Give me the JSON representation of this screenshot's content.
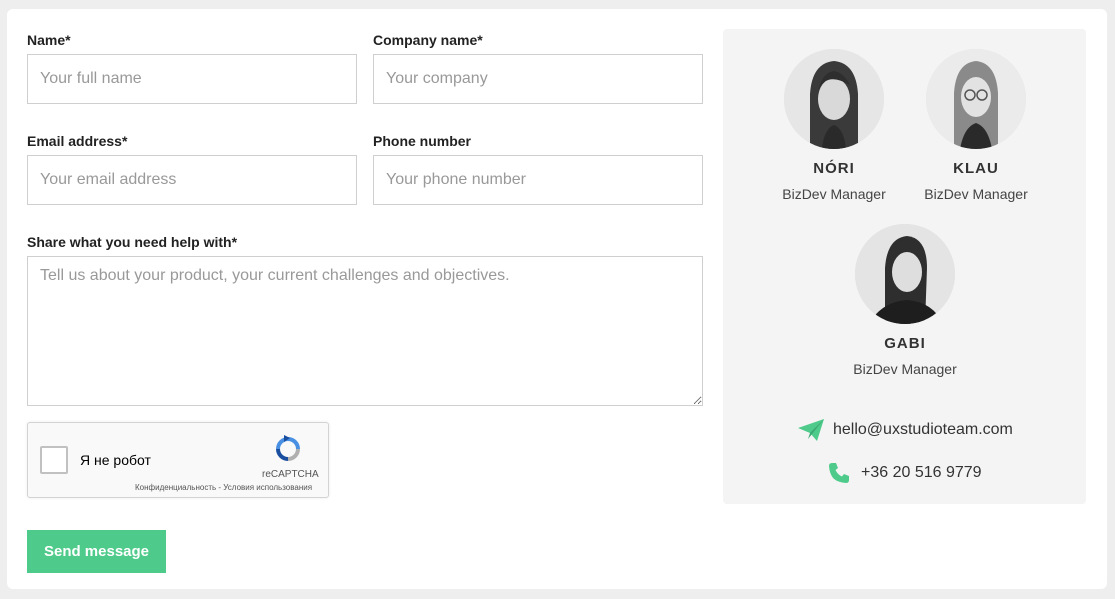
{
  "form": {
    "name_label": "Name*",
    "name_placeholder": "Your full name",
    "company_label": "Company name*",
    "company_placeholder": "Your company",
    "email_label": "Email address*",
    "email_placeholder": "Your email address",
    "phone_label": "Phone number",
    "phone_placeholder": "Your phone number",
    "help_label": "Share what you need help with*",
    "help_placeholder": "Tell us about your product, your current challenges and objectives.",
    "send_label": "Send message"
  },
  "captcha": {
    "label": "Я не робот",
    "brand": "reCAPTCHA",
    "links": "Конфиденциальность - Условия использования"
  },
  "team": [
    {
      "name": "NÓRI",
      "role": "BizDev Manager"
    },
    {
      "name": "KLAU",
      "role": "BizDev Manager"
    },
    {
      "name": "GABI",
      "role": "BizDev Manager"
    }
  ],
  "contact": {
    "email": "hello@uxstudioteam.com",
    "phone": "+36 20 516 9779",
    "icon_email": "paper-plane-icon",
    "icon_phone": "phone-icon"
  },
  "colors": {
    "accent": "#4ecb8a",
    "panel": "#f4f4f4"
  }
}
